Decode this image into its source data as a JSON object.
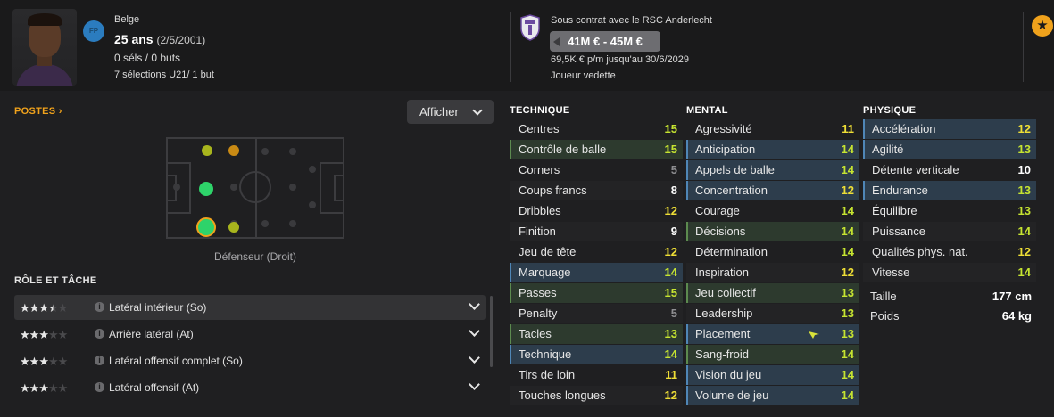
{
  "header": {
    "nationality": "Belge",
    "position_badge": "FP",
    "age_label": "25 ans",
    "birthdate": "(2/5/2001)",
    "caps": "0 séls / 0 buts",
    "u21": "7 sélections U21/ 1 but",
    "contract": "Sous contrat avec le RSC Anderlecht",
    "value": "41M € - 45M €",
    "wage": "69,5K € p/m jusqu'au 30/6/2029",
    "status": "Joueur vedette"
  },
  "positions": {
    "title": "POSTES",
    "show_button": "Afficher",
    "caption": "Défenseur (Droit)"
  },
  "roles": {
    "title": "RÔLE ET TÂCHE",
    "items": [
      {
        "stars": 3.5,
        "name": "Latéral intérieur (So)"
      },
      {
        "stars": 3,
        "name": "Arrière latéral (At)"
      },
      {
        "stars": 3,
        "name": "Latéral offensif complet (So)"
      },
      {
        "stars": 3,
        "name": "Latéral offensif (At)"
      }
    ]
  },
  "technique": {
    "title": "TECHNIQUE",
    "rows": [
      {
        "label": "Centres",
        "value": "15"
      },
      {
        "label": "Contrôle de balle",
        "value": "15"
      },
      {
        "label": "Corners",
        "value": "5"
      },
      {
        "label": "Coups francs",
        "value": "8"
      },
      {
        "label": "Dribbles",
        "value": "12"
      },
      {
        "label": "Finition",
        "value": "9"
      },
      {
        "label": "Jeu de tête",
        "value": "12"
      },
      {
        "label": "Marquage",
        "value": "14"
      },
      {
        "label": "Passes",
        "value": "15"
      },
      {
        "label": "Penalty",
        "value": "5"
      },
      {
        "label": "Tacles",
        "value": "13"
      },
      {
        "label": "Technique",
        "value": "14"
      },
      {
        "label": "Tirs de loin",
        "value": "11"
      },
      {
        "label": "Touches longues",
        "value": "12"
      }
    ]
  },
  "mental": {
    "title": "MENTAL",
    "rows": [
      {
        "label": "Agressivité",
        "value": "11"
      },
      {
        "label": "Anticipation",
        "value": "14"
      },
      {
        "label": "Appels de balle",
        "value": "14"
      },
      {
        "label": "Concentration",
        "value": "12"
      },
      {
        "label": "Courage",
        "value": "14"
      },
      {
        "label": "Décisions",
        "value": "14"
      },
      {
        "label": "Détermination",
        "value": "14"
      },
      {
        "label": "Inspiration",
        "value": "12"
      },
      {
        "label": "Jeu collectif",
        "value": "13"
      },
      {
        "label": "Leadership",
        "value": "13"
      },
      {
        "label": "Placement",
        "value": "13"
      },
      {
        "label": "Sang-froid",
        "value": "14"
      },
      {
        "label": "Vision du jeu",
        "value": "14"
      },
      {
        "label": "Volume de jeu",
        "value": "14"
      }
    ]
  },
  "physique": {
    "title": "PHYSIQUE",
    "rows": [
      {
        "label": "Accélération",
        "value": "12"
      },
      {
        "label": "Agilité",
        "value": "13"
      },
      {
        "label": "Détente verticale",
        "value": "10"
      },
      {
        "label": "Endurance",
        "value": "13"
      },
      {
        "label": "Équilibre",
        "value": "13"
      },
      {
        "label": "Puissance",
        "value": "14"
      },
      {
        "label": "Qualités phys. nat.",
        "value": "12"
      },
      {
        "label": "Vitesse",
        "value": "14"
      }
    ],
    "height_label": "Taille",
    "height_value": "177 cm",
    "weight_label": "Poids",
    "weight_value": "64 kg"
  },
  "colors": {
    "accent": "#f0a21c",
    "value_yellow": "#eede36",
    "value_green_yellow": "#c6e431",
    "highlight_blue": "#2d3d4c",
    "highlight_green": "#2d3a2e"
  }
}
